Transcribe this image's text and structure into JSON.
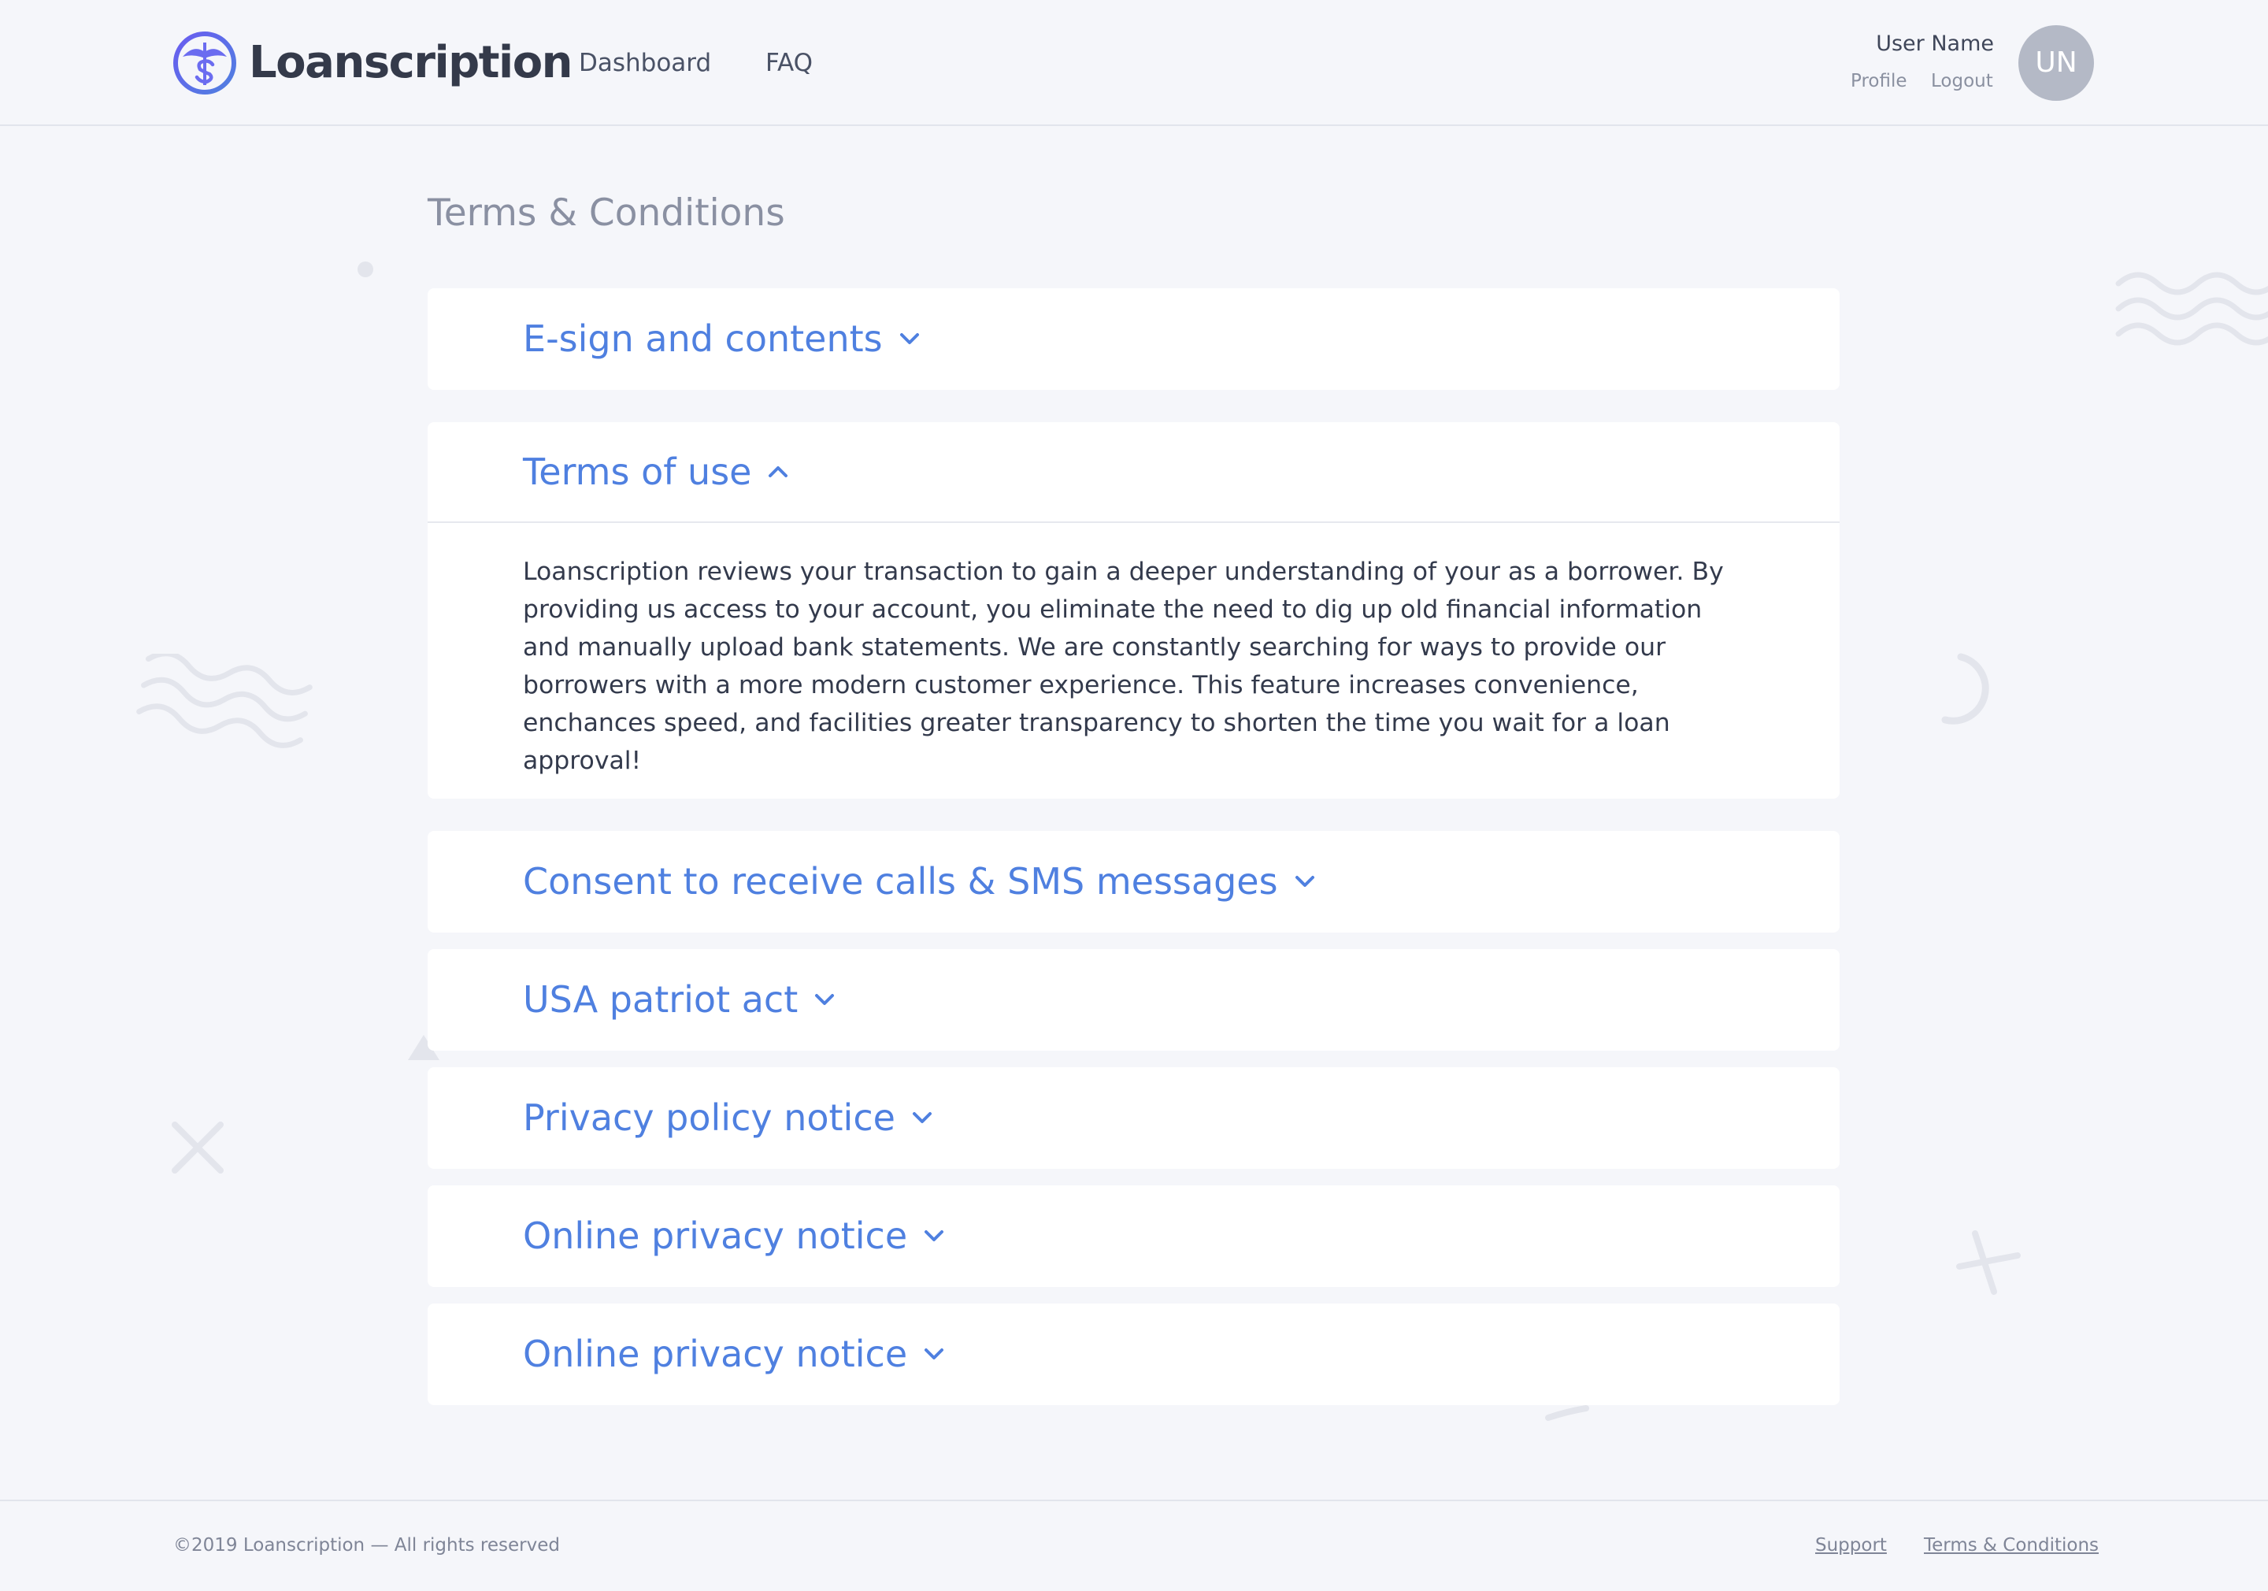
{
  "header": {
    "brand": "Loanscription",
    "logo_icon": "caduceus-dollar-icon",
    "nav": [
      {
        "label": "Dashboard"
      },
      {
        "label": "FAQ"
      }
    ],
    "user": {
      "name": "User Name",
      "profile_label": "Profile",
      "logout_label": "Logout",
      "initials": "UN"
    }
  },
  "main": {
    "title": "Terms & Conditions",
    "sections": [
      {
        "title": "E-sign and contents",
        "expanded": false
      },
      {
        "title": "Terms of use",
        "expanded": true,
        "body": "Loanscription reviews your transaction to gain a deeper understanding of your as a borrower. By providing us access to your account, you eliminate the need to dig up old financial information and manually upload bank statements. We are constantly searching for ways to provide our borrowers with a more modern customer experience. This feature increases convenience, enchances speed, and facilities greater transparency to shorten the time you wait for a loan approval!"
      },
      {
        "title": "Consent to receive calls & SMS messages",
        "expanded": false
      },
      {
        "title": "USA patriot act",
        "expanded": false
      },
      {
        "title": "Privacy policy notice",
        "expanded": false
      },
      {
        "title": "Online privacy notice",
        "expanded": false
      },
      {
        "title": "Online privacy notice",
        "expanded": false
      }
    ]
  },
  "footer": {
    "copyright": "©2019 Loanscription — All rights reserved",
    "links": [
      {
        "label": "Support"
      },
      {
        "label": "Terms & Conditions"
      }
    ]
  },
  "colors": {
    "accent": "#4f80e0",
    "background": "#f5f6fa",
    "panel": "#ffffff",
    "avatar": "#b4b9c6",
    "logo_gradient_start": "#6a5cf0",
    "logo_gradient_end": "#4f80e0"
  }
}
